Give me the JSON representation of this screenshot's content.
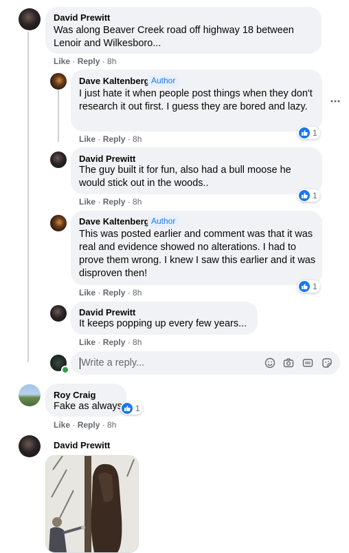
{
  "comments": [
    {
      "name": "David Prewitt",
      "author": "",
      "text": "Was along Beaver Creek road off highway 18 between Lenoir and Wilkesboro...",
      "like": "Like",
      "reply": "Reply",
      "time": "8h",
      "reactions": ""
    },
    {
      "name": "Dave Kaltenberg",
      "author": "Author",
      "text": "I just hate it when people post things when they don't research it out first. I guess they are bored and lazy.",
      "like": "Like",
      "reply": "Reply",
      "time": "8h",
      "reactions": "1"
    },
    {
      "name": "David Prewitt",
      "author": "",
      "text": "The guy built it for fun, also had a bull moose he would stick out in the woods..",
      "like": "Like",
      "reply": "Reply",
      "time": "8h",
      "reactions": "1"
    },
    {
      "name": "Dave Kaltenberg",
      "author": "Author",
      "text": "This was posted earlier and comment was that it was real and evidence showed no alterations. I had to prove them wrong. I knew I saw this earlier and it was disproven then!",
      "like": "Like",
      "reply": "Reply",
      "time": "8h",
      "reactions": "1"
    },
    {
      "name": "David Prewitt",
      "author": "",
      "text": "It keeps popping up every few years...",
      "like": "Like",
      "reply": "Reply",
      "time": "8h",
      "reactions": ""
    },
    {
      "name": "Roy Craig",
      "author": "",
      "text": "Fake as always",
      "like": "Like",
      "reply": "Reply",
      "time": "8h",
      "reactions": "1"
    },
    {
      "name": "David Prewitt",
      "author": "",
      "text": "",
      "like": "",
      "reply": "",
      "time": "",
      "reactions": ""
    }
  ],
  "reply_box": {
    "placeholder": "Write a reply..."
  },
  "separator": " · ",
  "icons": {
    "more": "more-options-icon",
    "emoji": "emoji-icon",
    "camera": "camera-icon",
    "gif": "gif-icon",
    "sticker": "sticker-icon",
    "like": "like-reaction-icon"
  },
  "colors": {
    "bubble": "#f0f2f5",
    "meta": "#65676b",
    "accent": "#1877f2"
  }
}
